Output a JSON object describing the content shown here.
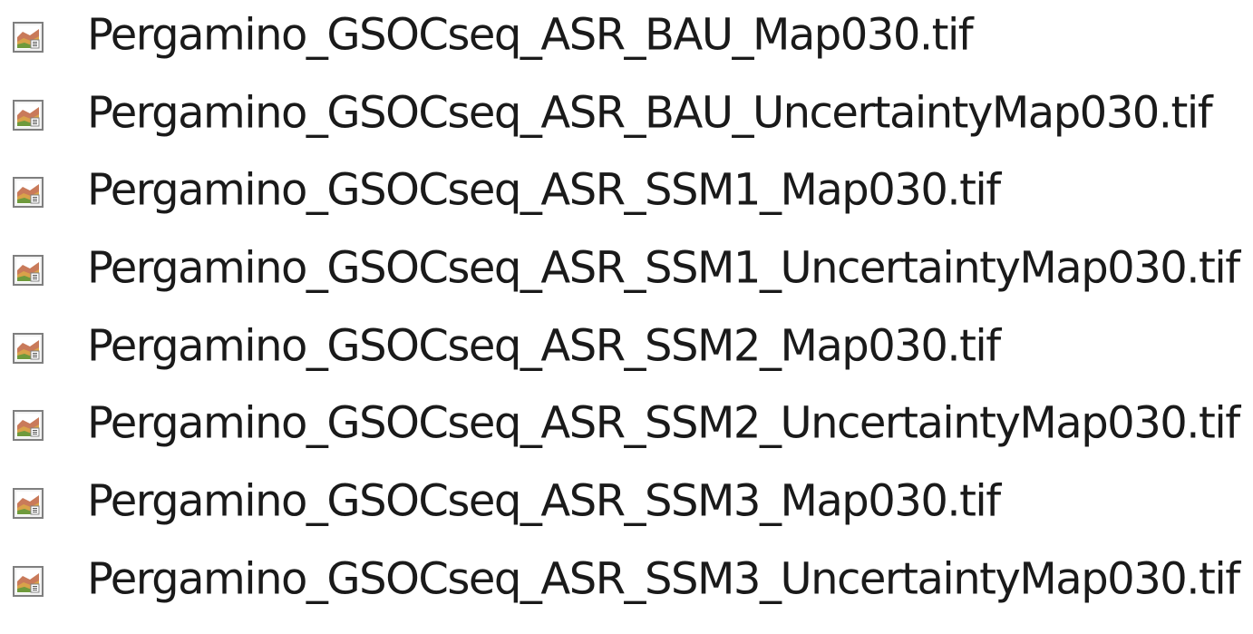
{
  "icon": "image-file-icon",
  "files": [
    {
      "name": "Pergamino_GSOCseq_ASR_BAU_Map030.tif"
    },
    {
      "name": "Pergamino_GSOCseq_ASR_BAU_UncertaintyMap030.tif"
    },
    {
      "name": "Pergamino_GSOCseq_ASR_SSM1_Map030.tif"
    },
    {
      "name": "Pergamino_GSOCseq_ASR_SSM1_UncertaintyMap030.tif"
    },
    {
      "name": "Pergamino_GSOCseq_ASR_SSM2_Map030.tif"
    },
    {
      "name": "Pergamino_GSOCseq_ASR_SSM2_UncertaintyMap030.tif"
    },
    {
      "name": "Pergamino_GSOCseq_ASR_SSM3_Map030.tif"
    },
    {
      "name": "Pergamino_GSOCseq_ASR_SSM3_UncertaintyMap030.tif"
    }
  ]
}
